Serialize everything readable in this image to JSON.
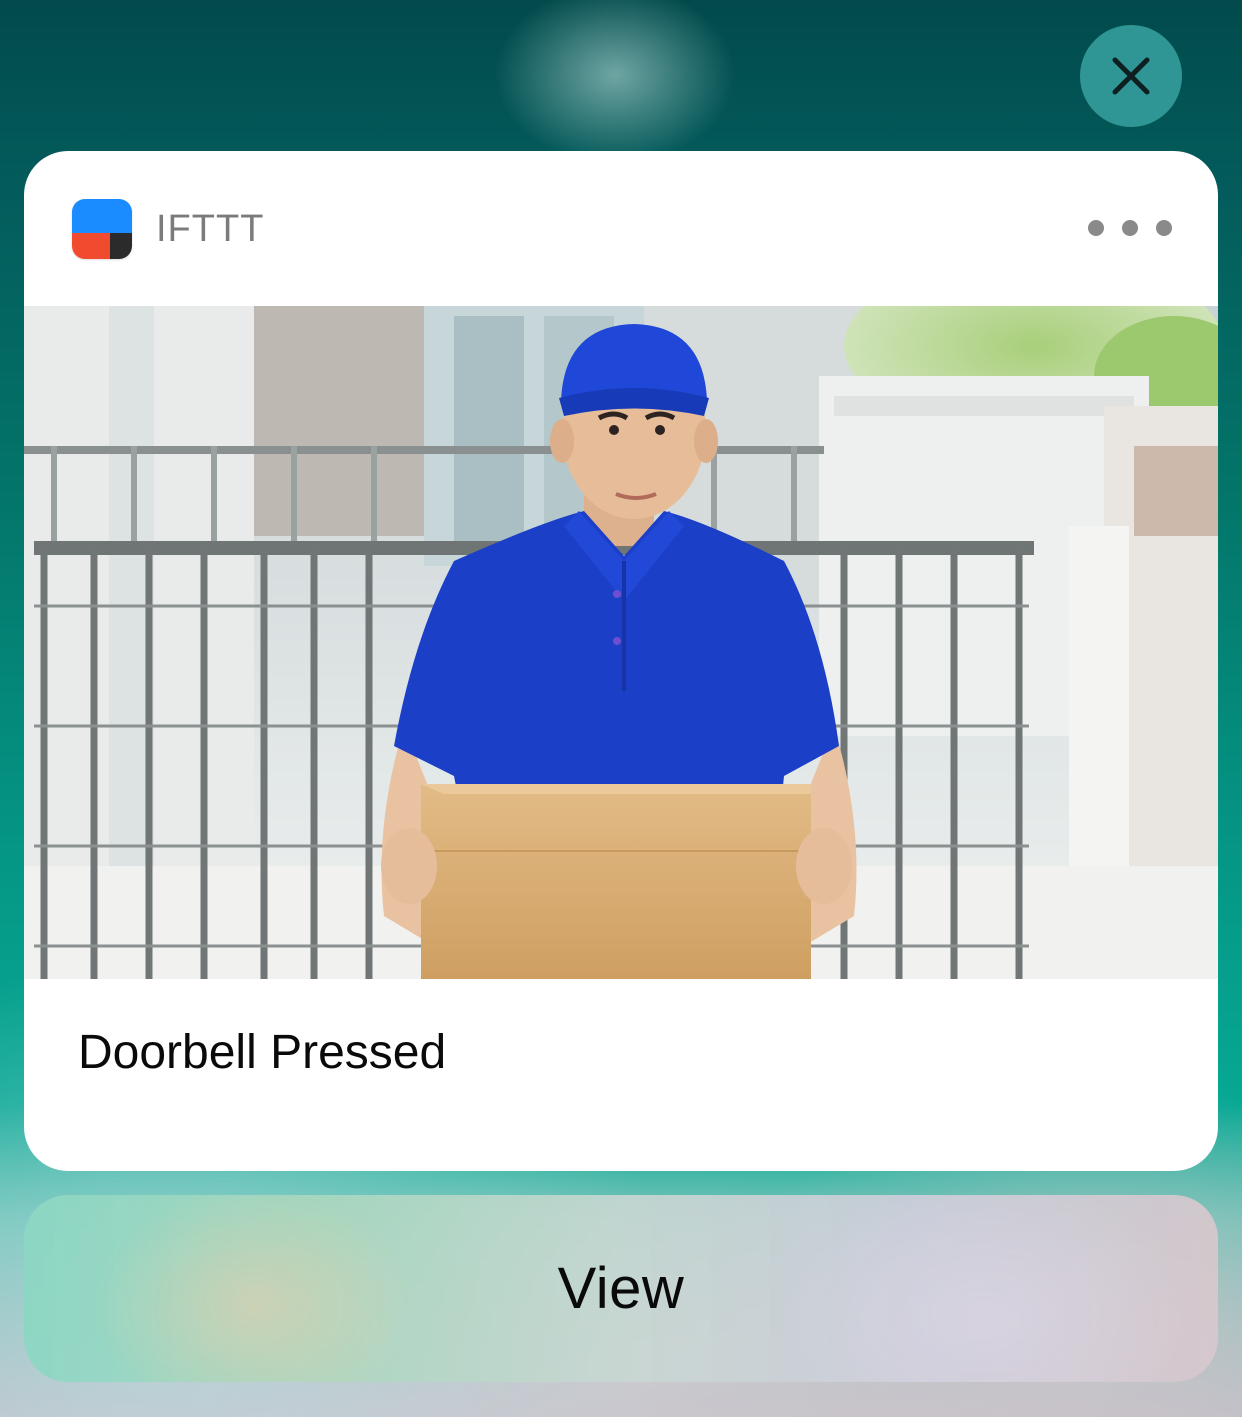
{
  "close_button": {
    "icon": "close-icon"
  },
  "notification": {
    "app": {
      "name": "IFTTT",
      "icon": "ifttt-app-icon",
      "icon_colors": {
        "top": "#1a8cff",
        "bottom_left": "#f04a2f",
        "bottom_right": "#2b2b2b"
      }
    },
    "more_icon": "ellipsis-icon",
    "image": "delivery-person-with-box-photo",
    "message": "Doorbell Pressed"
  },
  "action": {
    "label": "View"
  }
}
